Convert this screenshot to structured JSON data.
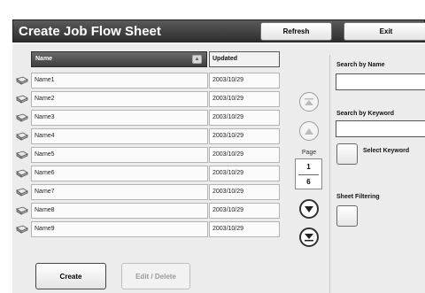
{
  "header": {
    "title": "Create Job Flow Sheet",
    "refresh_label": "Refresh",
    "exit_label": "Exit"
  },
  "table": {
    "columns": [
      "Name",
      "Updated"
    ],
    "rows": [
      {
        "name": "Name1",
        "updated": "2003/10/29"
      },
      {
        "name": "Name2",
        "updated": "2003/10/29"
      },
      {
        "name": "Name3",
        "updated": "2003/10/29"
      },
      {
        "name": "Name4",
        "updated": "2003/10/29"
      },
      {
        "name": "Name5",
        "updated": "2003/10/29"
      },
      {
        "name": "Name6",
        "updated": "2003/10/29"
      },
      {
        "name": "Name7",
        "updated": "2003/10/29"
      },
      {
        "name": "Name8",
        "updated": "2003/10/29"
      },
      {
        "name": "Name9",
        "updated": "2003/10/29"
      }
    ]
  },
  "pager": {
    "label": "Page",
    "current": "1",
    "total": "6"
  },
  "side": {
    "search_by_name_label": "Search by Name",
    "search_by_name_value": "",
    "search_by_keyword_label": "Search by Keyword",
    "search_by_keyword_value": "",
    "select_keyword_label": "Select Keyword",
    "sheet_filtering_label": "Sheet Filtering"
  },
  "footer": {
    "create_label": "Create",
    "edit_delete_label": "Edit / Delete"
  },
  "colors": {
    "title_bar": "#3f3f3f",
    "panel": "#ececec",
    "disabled_text": "#9a9a9a"
  }
}
